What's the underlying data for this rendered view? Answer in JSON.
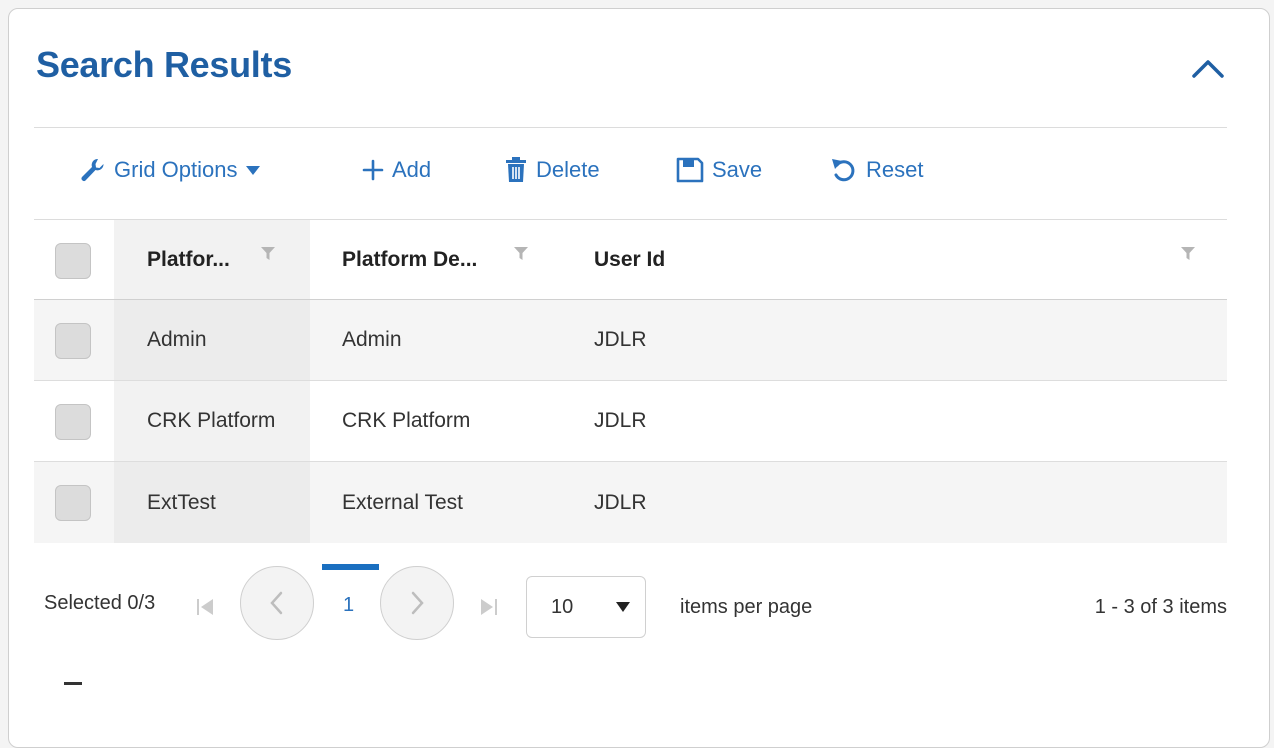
{
  "panel": {
    "title": "Search Results",
    "collapse_icon": "chevron-up-icon"
  },
  "toolbar": {
    "grid_options_label": "Grid Options",
    "add_label": "Add",
    "delete_label": "Delete",
    "save_label": "Save",
    "reset_label": "Reset"
  },
  "grid": {
    "columns": [
      "Platfor...",
      "Platform De...",
      "User Id"
    ],
    "rows": [
      [
        "Admin",
        "Admin",
        "JDLR"
      ],
      [
        "CRK Platform",
        "CRK Platform",
        "JDLR"
      ],
      [
        "ExtTest",
        "External Test",
        "JDLR"
      ]
    ]
  },
  "pager": {
    "selected": "Selected 0/3",
    "current_page": "1",
    "page_size": "10",
    "items_per_page": "items per page",
    "summary": "1 - 3 of 3 items"
  },
  "footer": {
    "dash": "–"
  },
  "colors": {
    "accent": "#2b72bd",
    "title": "#1f5fa3",
    "active_page": "#1a6fc0"
  }
}
